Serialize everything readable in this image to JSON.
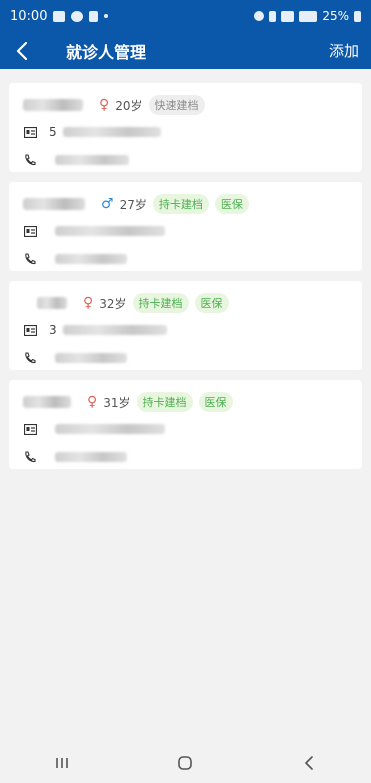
{
  "status_bar": {
    "time": "10:00",
    "battery": "25%"
  },
  "header": {
    "title": "就诊人管理",
    "add_label": "添加"
  },
  "patients": [
    {
      "gender_symbol": "♀",
      "age": "20岁",
      "tags": [
        "快速建档"
      ],
      "id_prefix": "5",
      "phone_prefix": ""
    },
    {
      "gender_symbol": "♂",
      "age": "27岁",
      "tags": [
        "持卡建档",
        "医保"
      ],
      "id_prefix": "",
      "phone_prefix": ""
    },
    {
      "gender_symbol": "♀",
      "age": "32岁",
      "tags": [
        "持卡建档",
        "医保"
      ],
      "id_prefix": "3",
      "phone_prefix": ""
    },
    {
      "gender_symbol": "♀",
      "age": "31岁",
      "tags": [
        "持卡建档",
        "医保"
      ],
      "id_prefix": "",
      "phone_prefix": ""
    }
  ],
  "colors": {
    "primary": "#0b57a9",
    "female": "#e0645a",
    "male": "#2b8bd6",
    "tag_green": "#4caf50"
  }
}
